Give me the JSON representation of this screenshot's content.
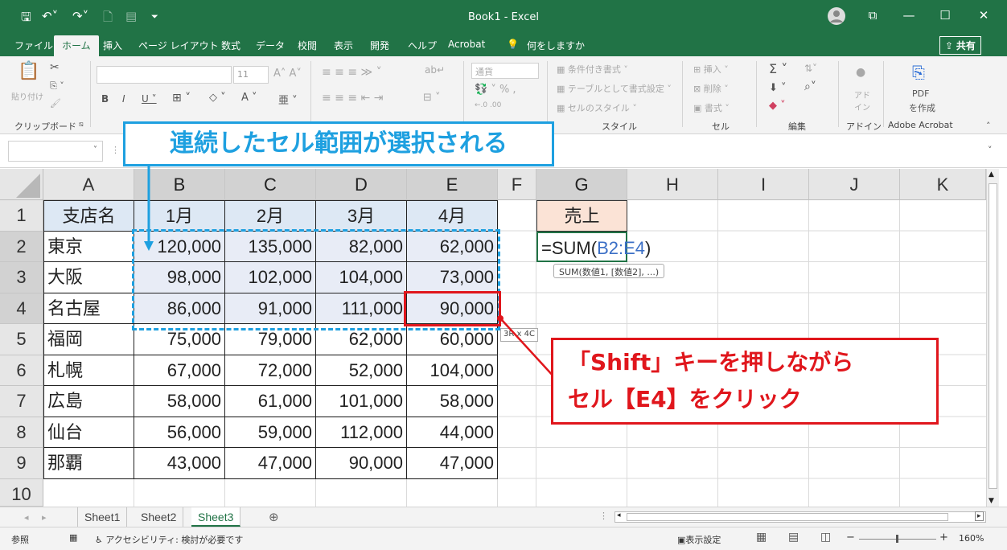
{
  "window": {
    "title": "Book1  -  Excel"
  },
  "tabs": [
    "ファイル",
    "ホーム",
    "挿入",
    "ページ レイアウト",
    "数式",
    "データ",
    "校閲",
    "表示",
    "開発",
    "ヘルプ",
    "Acrobat"
  ],
  "tell_me": "何をしますか",
  "share_label": "共有",
  "ribbon": {
    "clipboard": {
      "paste": "貼り付け",
      "group": "クリップボード"
    },
    "font": {
      "size": "11"
    },
    "number": {
      "format": "通貨"
    },
    "styles": {
      "cond": "条件付き書式",
      "table": "テーブルとして書式設定",
      "cell_style": "セルのスタイル",
      "group": "スタイル"
    },
    "cells": {
      "insert": "挿入",
      "delete": "削除",
      "format": "書式",
      "group": "セル"
    },
    "editing": {
      "group": "編集"
    },
    "addins": {
      "label": "アド\nイン",
      "group": "アドイン"
    },
    "acrobat": {
      "pdf": "PDF",
      "create": "を作成",
      "group": "Adobe Acrobat"
    }
  },
  "columns": [
    "A",
    "B",
    "C",
    "D",
    "E",
    "F",
    "G",
    "H",
    "I",
    "J",
    "K"
  ],
  "rows": [
    "1",
    "2",
    "3",
    "4",
    "5",
    "6",
    "7",
    "8",
    "9",
    "10"
  ],
  "table": {
    "header": [
      "支店名",
      "1月",
      "2月",
      "3月",
      "4月"
    ],
    "data": [
      [
        "東京",
        "120,000",
        "135,000",
        "82,000",
        "62,000"
      ],
      [
        "大阪",
        "98,000",
        "102,000",
        "104,000",
        "73,000"
      ],
      [
        "名古屋",
        "86,000",
        "91,000",
        "111,000",
        "90,000"
      ],
      [
        "福岡",
        "75,000",
        "79,000",
        "62,000",
        "60,000"
      ],
      [
        "札幌",
        "67,000",
        "72,000",
        "52,000",
        "104,000"
      ],
      [
        "広島",
        "58,000",
        "61,000",
        "101,000",
        "58,000"
      ],
      [
        "仙台",
        "56,000",
        "59,000",
        "112,000",
        "44,000"
      ],
      [
        "那覇",
        "43,000",
        "47,000",
        "90,000",
        "47,000"
      ]
    ]
  },
  "g1": "売上",
  "formula": {
    "prefix": "=SUM(",
    "ref": "B2:E4",
    "suffix": ")"
  },
  "tooltip": "SUM(数値1, [数値2], ...)",
  "size_tip": "3R x 4C",
  "sheets": [
    "Sheet1",
    "Sheet2",
    "Sheet3"
  ],
  "status": {
    "mode": "参照",
    "accessibility": "アクセシビリティ: 検討が必要です",
    "display": "表示設定",
    "zoom": "160%"
  },
  "callouts": {
    "top": "連続したセル範囲が選択される",
    "bottom_line1": "「Shift」キーを押しながら",
    "bottom_line2": "セル【E4】をクリック"
  },
  "colors": {
    "excel_green": "#217346",
    "callout_blue": "#1ea0e0",
    "callout_red": "#e0161c"
  }
}
